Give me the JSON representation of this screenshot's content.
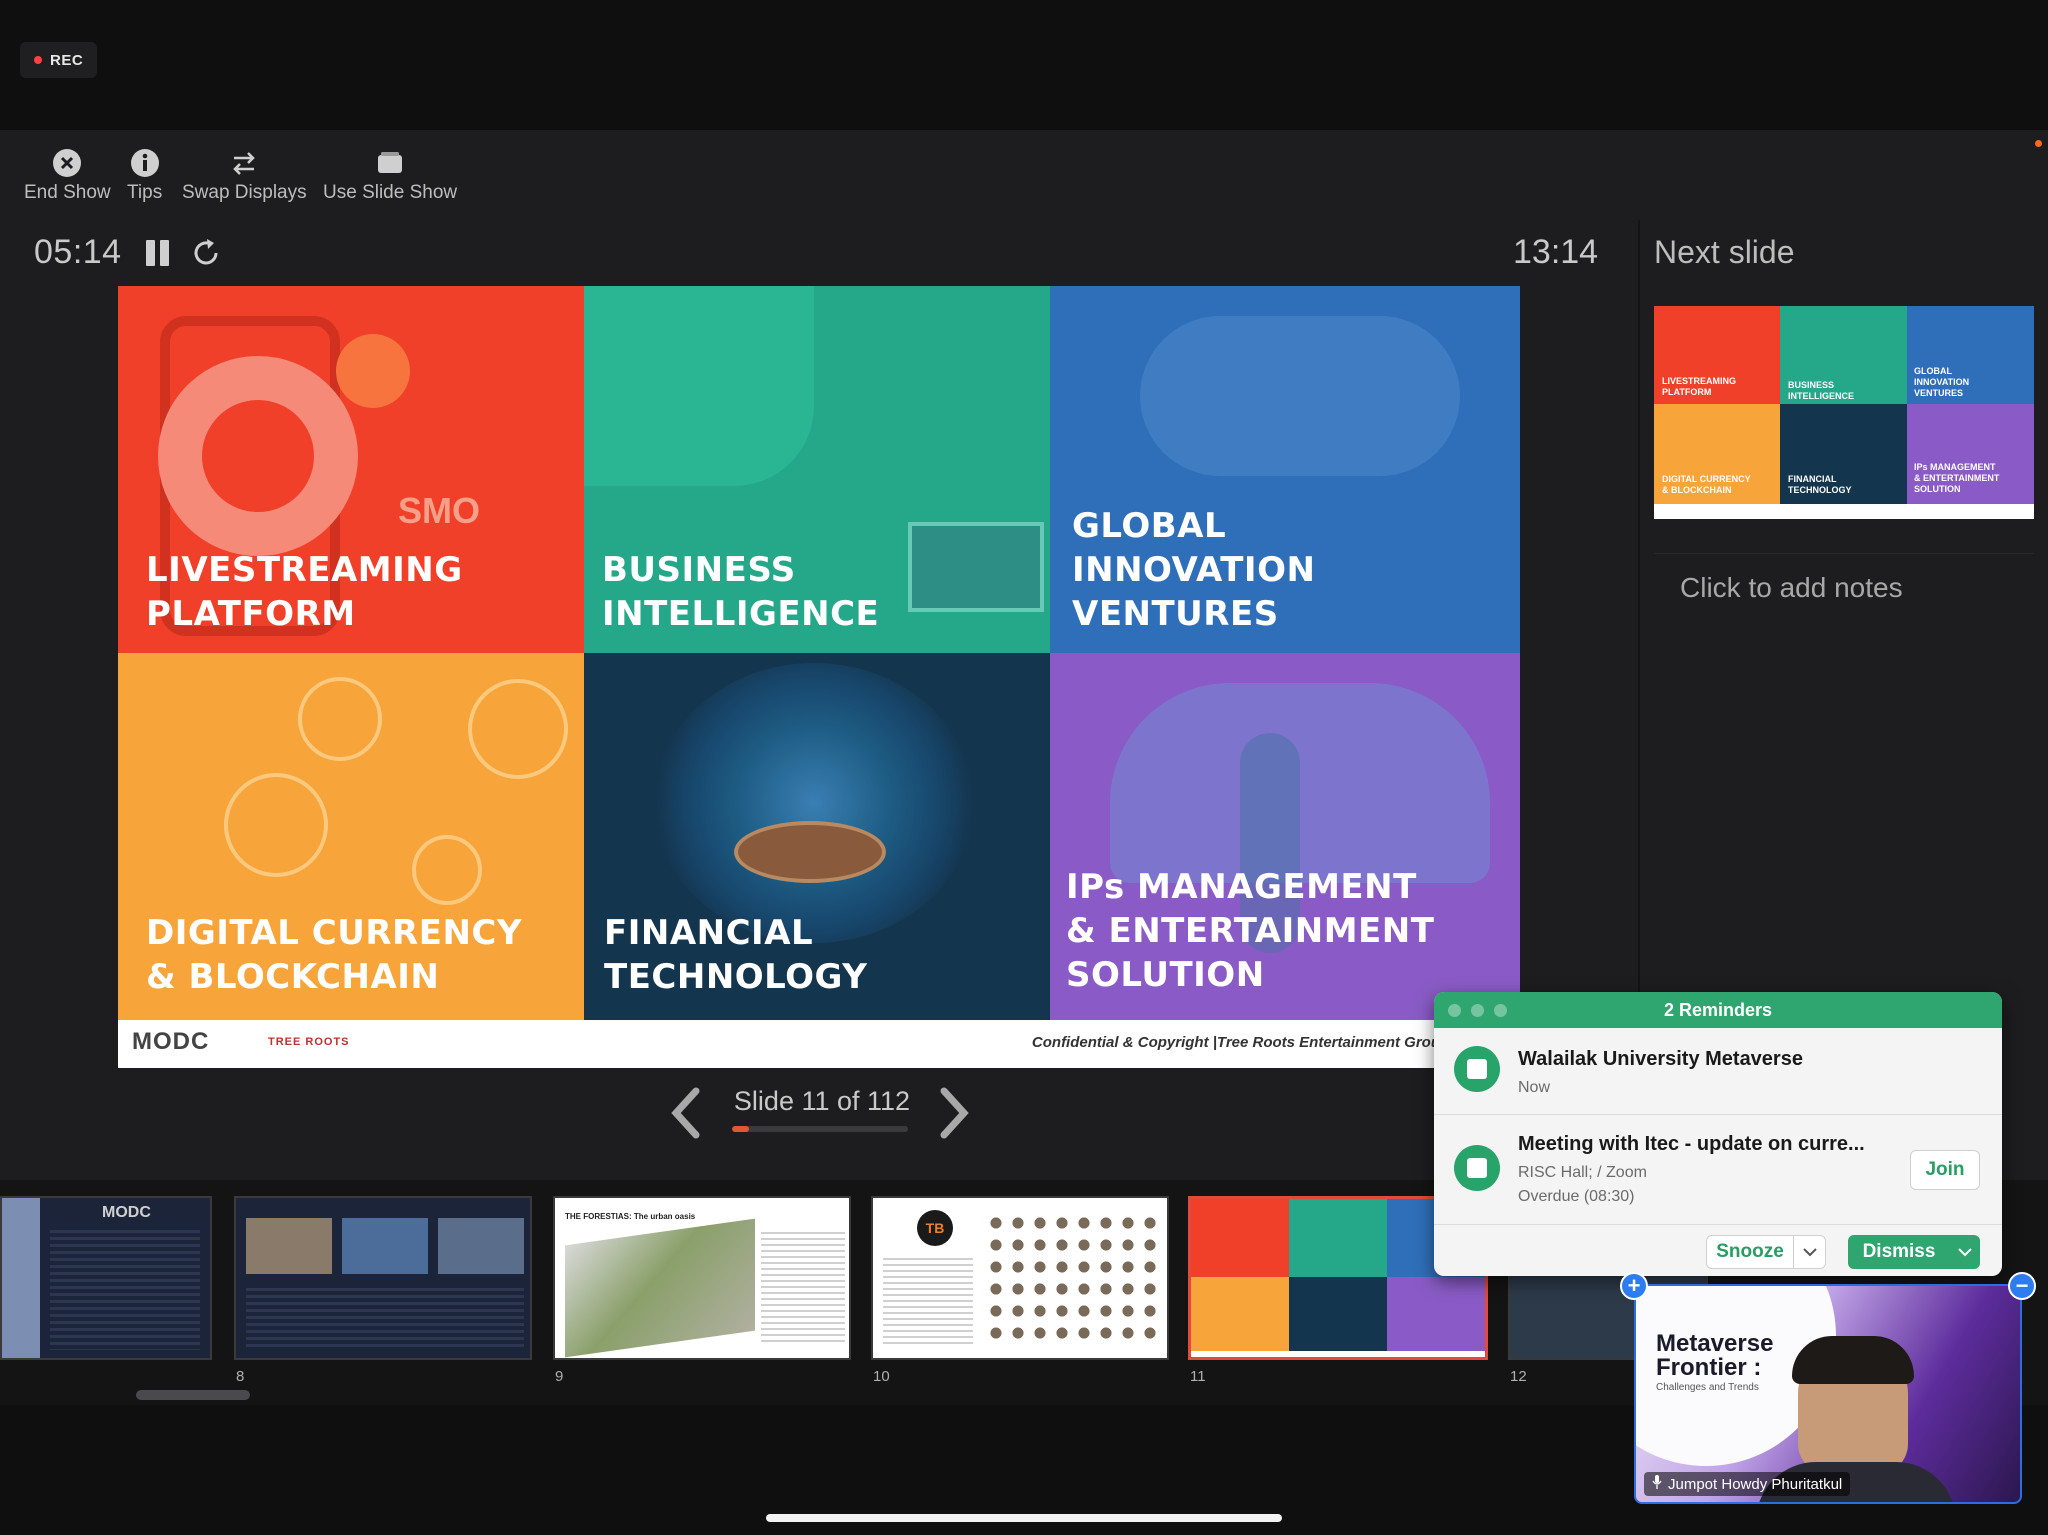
{
  "recording": {
    "label": "REC"
  },
  "toolbar": [
    {
      "label": "End Show",
      "icon": "close-circle-icon"
    },
    {
      "label": "Tips",
      "icon": "info-icon"
    },
    {
      "label": "Swap Displays",
      "icon": "swap-icon"
    },
    {
      "label": "Use Slide Show",
      "icon": "slideshow-icon"
    }
  ],
  "timer": {
    "elapsed": "05:14",
    "clock": "13:14"
  },
  "next_slide": {
    "heading": "Next slide",
    "notes_placeholder": "Click to add notes"
  },
  "slide": {
    "tiles": [
      {
        "label": "LIVESTREAMING\nPLATFORM",
        "logo": "SMO",
        "color": "#f0402a"
      },
      {
        "label": "BUSINESS\nINTELLIGENCE",
        "color": "#25a88a"
      },
      {
        "label": "GLOBAL\nINNOVATION\nVENTURES",
        "color": "#2f6fba"
      },
      {
        "label": "DIGITAL CURRENCY\n& BLOCKCHAIN",
        "color": "#f7a43a"
      },
      {
        "label": "FINANCIAL\nTECHNOLOGY",
        "color": "#14354e"
      },
      {
        "label": "IPs MANAGEMENT\n& ENTERTAINMENT\nSOLUTION",
        "color": "#8a5bc6"
      }
    ],
    "footer_logo": "MODC",
    "footer_logo2": "TREE ROOTS",
    "footer_text": "Confidential & Copyright |Tree Roots Entertainment Group Co., Lt"
  },
  "navigator": {
    "counter": "Slide 11 of 112",
    "current": 11,
    "total": 112
  },
  "filmstrip": [
    {
      "num": "",
      "title": "MODC"
    },
    {
      "num": "8",
      "title": ""
    },
    {
      "num": "9",
      "title": "THE FORESTIAS: The urban oasis"
    },
    {
      "num": "10",
      "title": "TB"
    },
    {
      "num": "11",
      "title": ""
    },
    {
      "num": "12",
      "title": ""
    }
  ],
  "reminders": {
    "header": "2 Reminders",
    "items": [
      {
        "title": "Walailak University Metaverse",
        "sub1": "Now",
        "sub2": ""
      },
      {
        "title": "Meeting with Itec - update on curre...",
        "sub1": "RISC Hall; / Zoom",
        "sub2": "Overdue (08:30)"
      }
    ],
    "join_label": "Join",
    "snooze_label": "Snooze",
    "dismiss_label": "Dismiss"
  },
  "video": {
    "title_line1": "Metaverse",
    "title_line2": "Frontier :",
    "subtitle": "Challenges and Trends",
    "participant": "Jumpot Howdy Phuritatkul"
  }
}
